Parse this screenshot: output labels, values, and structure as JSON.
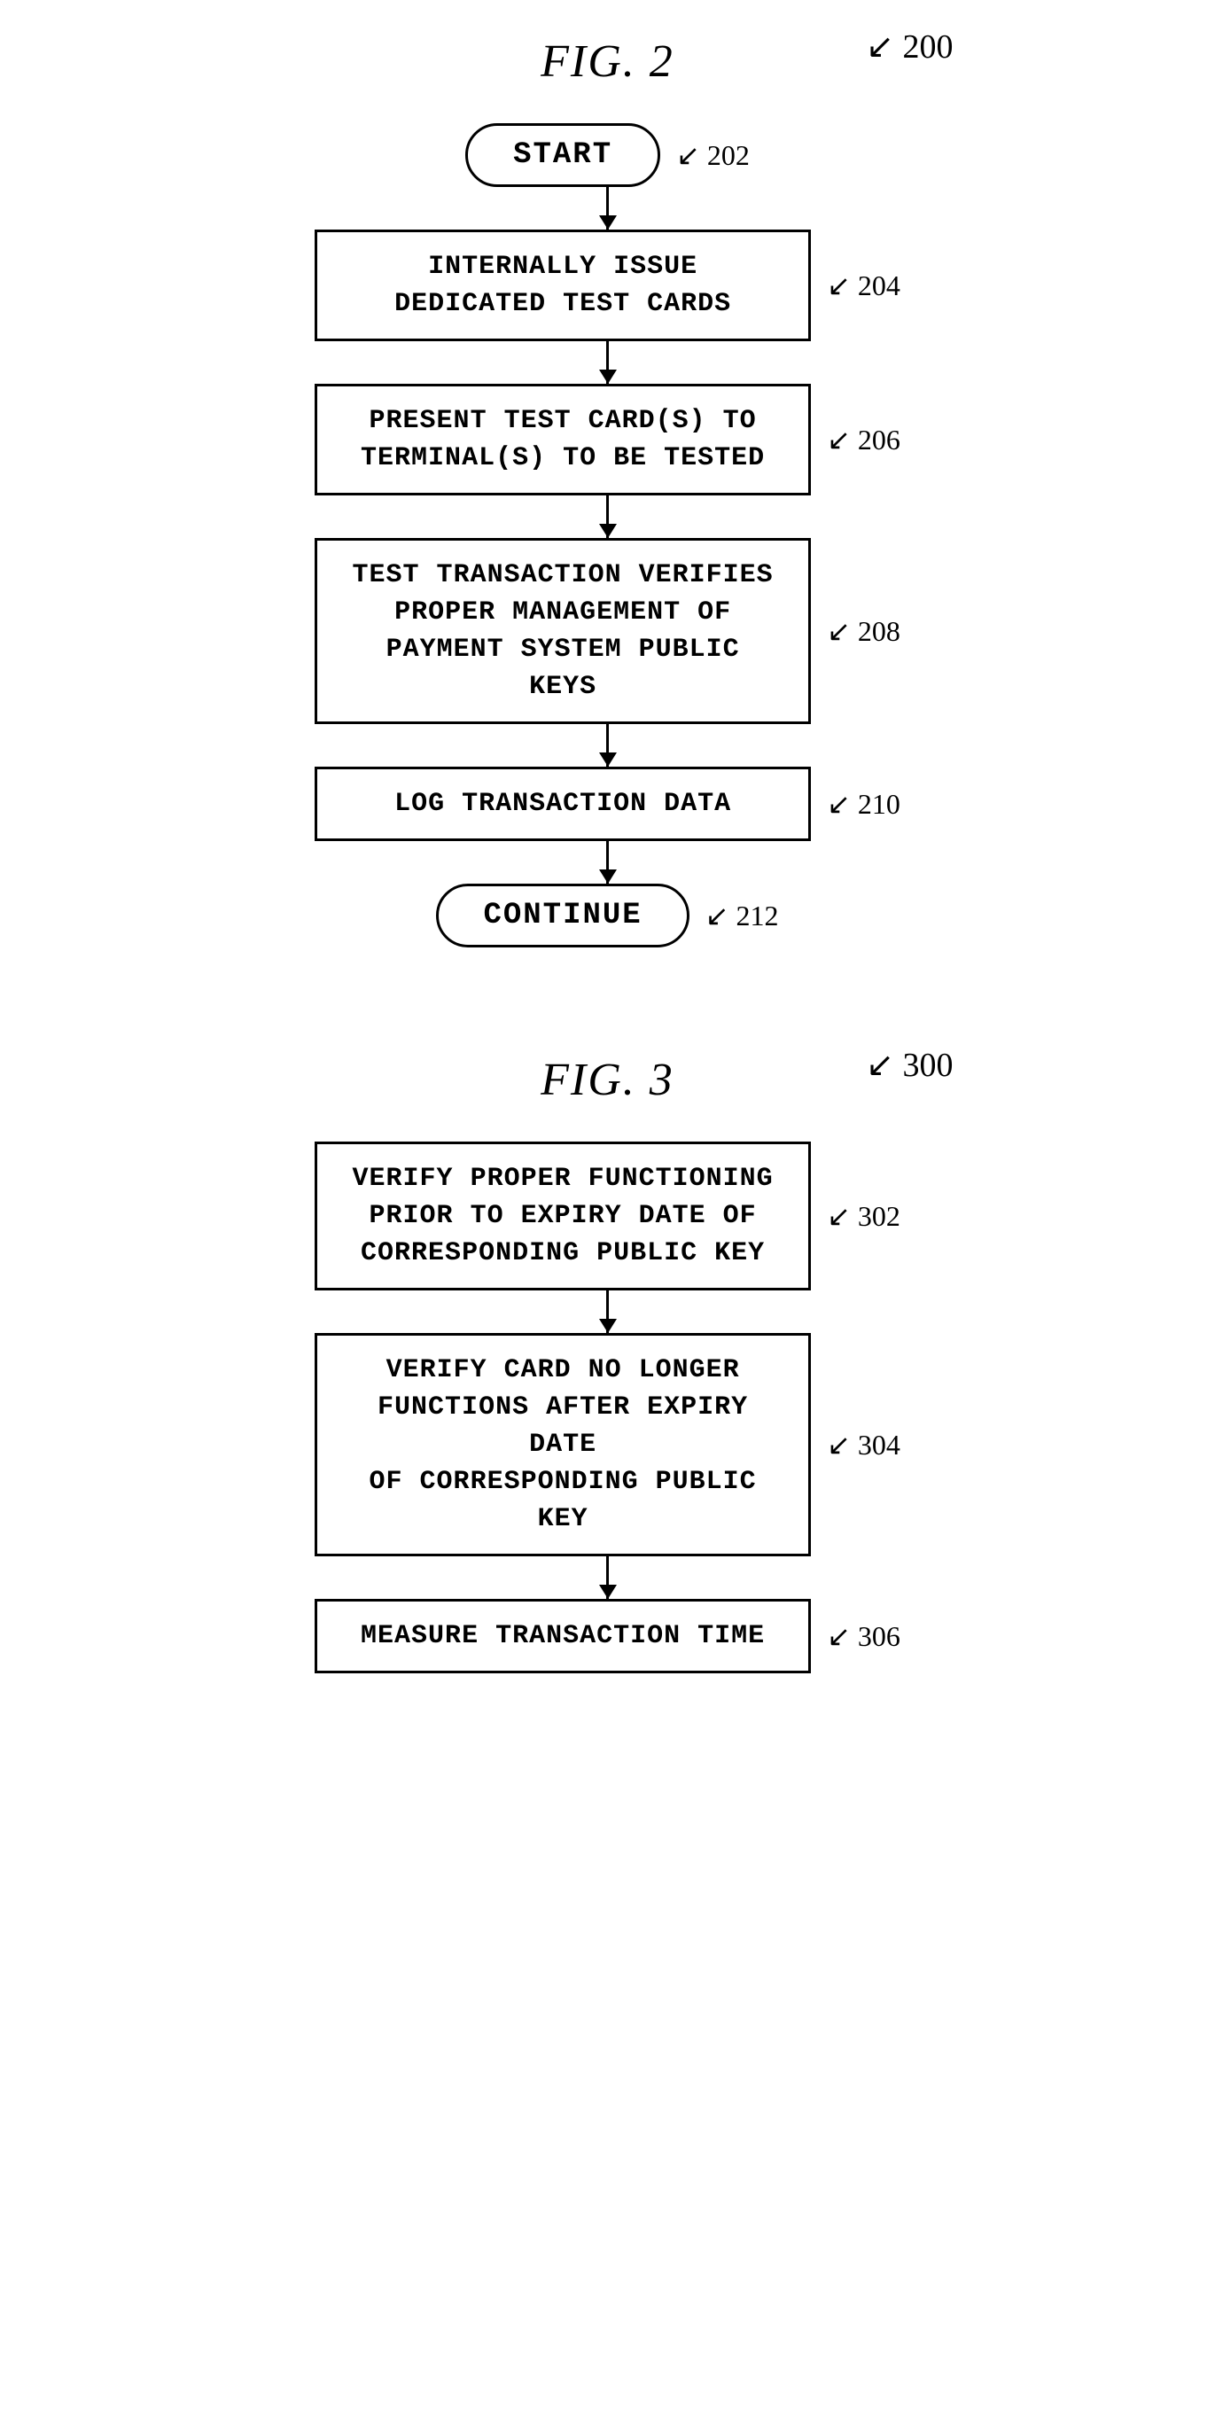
{
  "fig2": {
    "title": "FIG. 2",
    "indicator": "200",
    "nodes": [
      {
        "id": "start",
        "type": "oval",
        "text": "START",
        "label": "202"
      },
      {
        "id": "step204",
        "type": "rect",
        "text": "INTERNALLY ISSUE\nDEDICATED TEST CARDS",
        "label": "204"
      },
      {
        "id": "step206",
        "type": "rect",
        "text": "PRESENT TEST CARD(S) TO\nTERMINAL(S) TO BE TESTED",
        "label": "206"
      },
      {
        "id": "step208",
        "type": "rect",
        "text": "TEST TRANSACTION VERIFIES\nPROPER MANAGEMENT OF\nPAYMENT SYSTEM PUBLIC KEYS",
        "label": "208"
      },
      {
        "id": "step210",
        "type": "rect",
        "text": "LOG TRANSACTION DATA",
        "label": "210"
      },
      {
        "id": "continue",
        "type": "oval",
        "text": "CONTINUE",
        "label": "212"
      }
    ]
  },
  "fig3": {
    "title": "FIG. 3",
    "indicator": "300",
    "nodes": [
      {
        "id": "step302",
        "type": "rect",
        "text": "VERIFY PROPER FUNCTIONING\nPRIOR TO EXPIRY DATE OF\nCORRESPONDING PUBLIC KEY",
        "label": "302"
      },
      {
        "id": "step304",
        "type": "rect",
        "text": "VERIFY CARD NO LONGER\nFUNCTIONS AFTER EXPIRY DATE\nOF CORRESPONDING PUBLIC KEY",
        "label": "304"
      },
      {
        "id": "step306",
        "type": "rect",
        "text": "MEASURE TRANSACTION TIME",
        "label": "306"
      }
    ]
  }
}
